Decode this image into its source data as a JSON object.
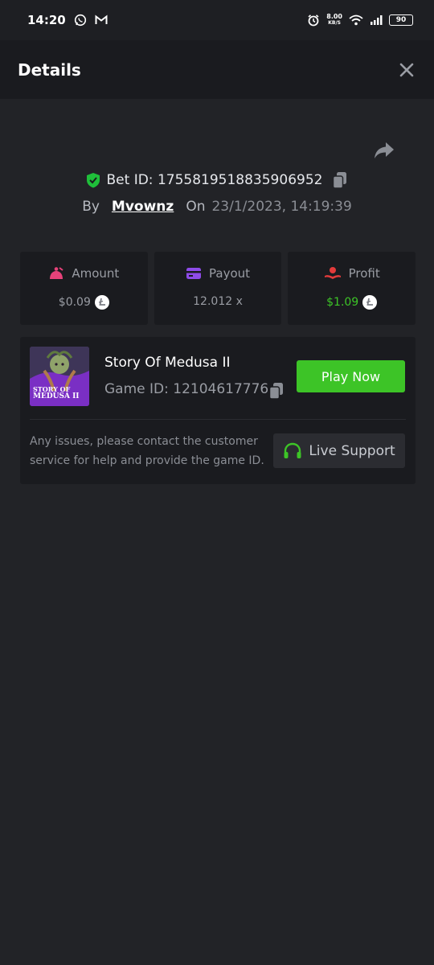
{
  "status_bar": {
    "time": "14:20",
    "speed_value": "8.00",
    "speed_unit": "KB/S",
    "battery": "90",
    "icons": [
      "whatsapp-icon",
      "gmail-icon",
      "alarm-icon",
      "wifi-icon",
      "signal-icon",
      "battery-icon"
    ]
  },
  "header": {
    "title": "Details"
  },
  "bet": {
    "label": "Bet ID:",
    "id": "1755819518835906952",
    "by_label": "By",
    "user": "Mvownz",
    "on_label": "On",
    "date": "23/1/2023, 14:19:39"
  },
  "stats": {
    "amount": {
      "label": "Amount",
      "value": "$0.09",
      "color": "#e7427a"
    },
    "payout": {
      "label": "Payout",
      "value": "12.012 x",
      "color": "#8e4be8"
    },
    "profit": {
      "label": "Profit",
      "value": "$1.09",
      "color": "#e33b3b",
      "value_color": "#3dc427"
    }
  },
  "game": {
    "title": "Story Of Medusa II",
    "id_label": "Game ID:",
    "id": "12104617776",
    "thumb_text_line1": "STORY OF",
    "thumb_text_line2": "MEDUSA II",
    "play_label": "Play Now",
    "support_text": "Any issues, please contact the customer service for help and provide the game ID.",
    "support_label": "Live Support"
  },
  "colors": {
    "accent_green": "#3dc427",
    "shield_green": "#1fbf3a"
  }
}
